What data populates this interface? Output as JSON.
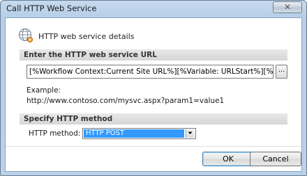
{
  "window": {
    "title": "Call HTTP Web Service",
    "close_symbol": "✕"
  },
  "header": {
    "label": "HTTP web service details",
    "icon": "globe-gear-icon"
  },
  "url_section": {
    "heading": "Enter the HTTP web service URL",
    "url_value": "[%Workflow Context:Current Site URL%][%Variable: URLStart%][%Variable: Organi",
    "browse_label": "...",
    "example_label": "Example:",
    "example_url": "http://www.contoso.com/mysvc.aspx?param1=value1"
  },
  "method_section": {
    "heading": "Specify HTTP method",
    "label": "HTTP method:",
    "selected": "HTTP POST"
  },
  "buttons": {
    "ok": "OK",
    "cancel": "Cancel"
  },
  "colors": {
    "selection": "#3399ff",
    "title_bar": "#c6daee"
  }
}
